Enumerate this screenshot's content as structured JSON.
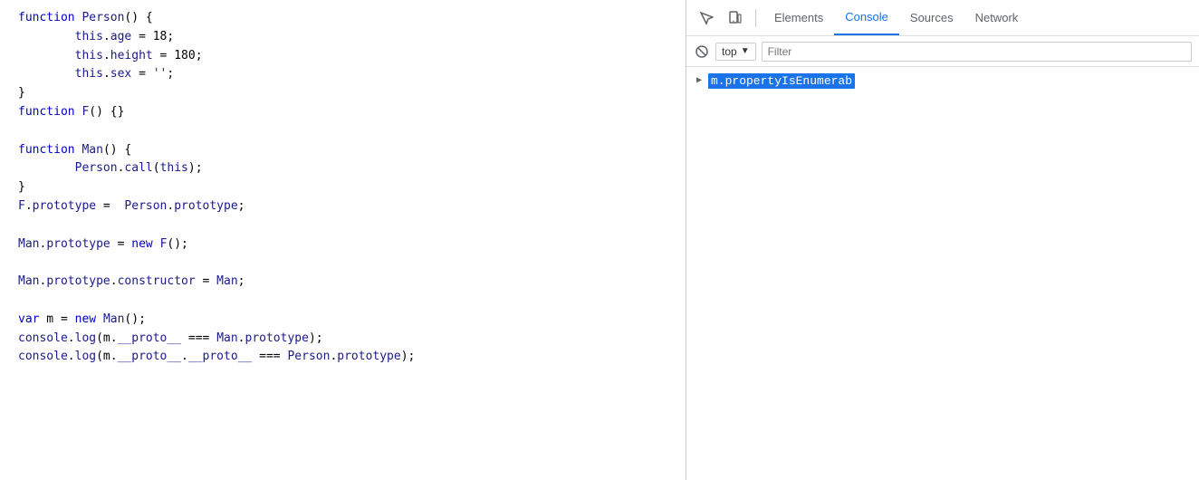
{
  "code_panel": {
    "lines": [
      {
        "type": "code",
        "content": "function Person() {"
      },
      {
        "type": "code",
        "content": "        this.age = 18;"
      },
      {
        "type": "code",
        "content": "        this.height = 180;"
      },
      {
        "type": "code",
        "content": "        this.sex = '';"
      },
      {
        "type": "code",
        "content": "}"
      },
      {
        "type": "code",
        "content": "function F() {}"
      },
      {
        "type": "blank"
      },
      {
        "type": "code",
        "content": "function Man() {"
      },
      {
        "type": "code",
        "content": "        Person.call(this);"
      },
      {
        "type": "code",
        "content": "}"
      },
      {
        "type": "code",
        "content": "F.prototype =  Person.prototype;"
      },
      {
        "type": "blank"
      },
      {
        "type": "code",
        "content": "Man.prototype = new F();"
      },
      {
        "type": "blank"
      },
      {
        "type": "code",
        "content": "Man.prototype.constructor = Man;"
      },
      {
        "type": "blank"
      },
      {
        "type": "code",
        "content": "var m = new Man();"
      },
      {
        "type": "code",
        "content": "console.log(m.__proto__ === Man.prototype);"
      },
      {
        "type": "code",
        "content": "console.log(m.__proto__.__proto__ === Person.prototype);"
      }
    ]
  },
  "devtools": {
    "toolbar": {
      "icon_inspect": "inspect-icon",
      "icon_device": "device-icon"
    },
    "tabs": [
      {
        "label": "Elements",
        "active": false
      },
      {
        "label": "Console",
        "active": true
      },
      {
        "label": "Sources",
        "active": false
      },
      {
        "label": "Network",
        "active": false
      }
    ],
    "console": {
      "context": "top",
      "filter_placeholder": "Filter",
      "entries": [
        {
          "arrow": "▶",
          "value": "m.propertyIsEnumerab"
        }
      ]
    }
  }
}
